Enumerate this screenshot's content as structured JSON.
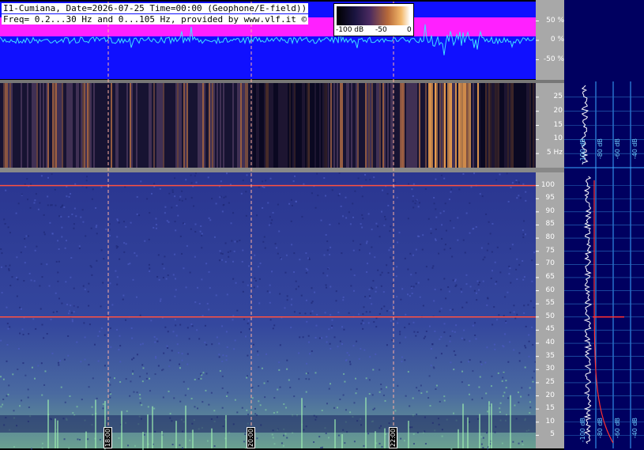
{
  "header": {
    "line1": "I1-Cumiana, Date=2026-07-25 Time=00:00 (Geophone/E-field))",
    "line2": "Freq= 0.2...30 Hz and 0...105 Hz, provided by www.vlf.it ©"
  },
  "colorbar": {
    "min_label": "-100 dB",
    "mid_label": "-50",
    "max_label": "0"
  },
  "colors": {
    "waveform_bg": "#1010ff",
    "waveform_band": "#ff20ff",
    "waveform_trace": "#40e0ff",
    "axis_bg": "#a8a8a8",
    "spectrum_bg": "#000060"
  },
  "chart_data": [
    {
      "type": "line",
      "title": "waveform",
      "ylabel_ticks": [
        "50 %",
        "0 %",
        "-50 %"
      ],
      "ylim": [
        -100,
        100
      ]
    },
    {
      "type": "heatmap",
      "title": "spectrogram 0.2-30 Hz",
      "yticks": [
        5,
        10,
        15,
        20,
        25
      ],
      "ytick_labels": [
        "5 Hz",
        "10",
        "15",
        "20",
        "25"
      ],
      "ylim": [
        0,
        30
      ]
    },
    {
      "type": "heatmap",
      "title": "spectrogram 0-105 Hz",
      "yticks": [
        5,
        10,
        15,
        20,
        25,
        30,
        35,
        40,
        45,
        50,
        55,
        60,
        65,
        70,
        75,
        80,
        85,
        90,
        95,
        100
      ],
      "ylim": [
        0,
        105
      ],
      "x_time_labels": [
        "18:00",
        "20:00",
        "22:00"
      ],
      "lines_hz": [
        50,
        100
      ]
    },
    {
      "type": "line",
      "title": "spectrum",
      "db_labels": [
        "-100 dB",
        "-80 dB",
        "-60 dB",
        "-40 dB",
        "-20 dB"
      ]
    }
  ]
}
